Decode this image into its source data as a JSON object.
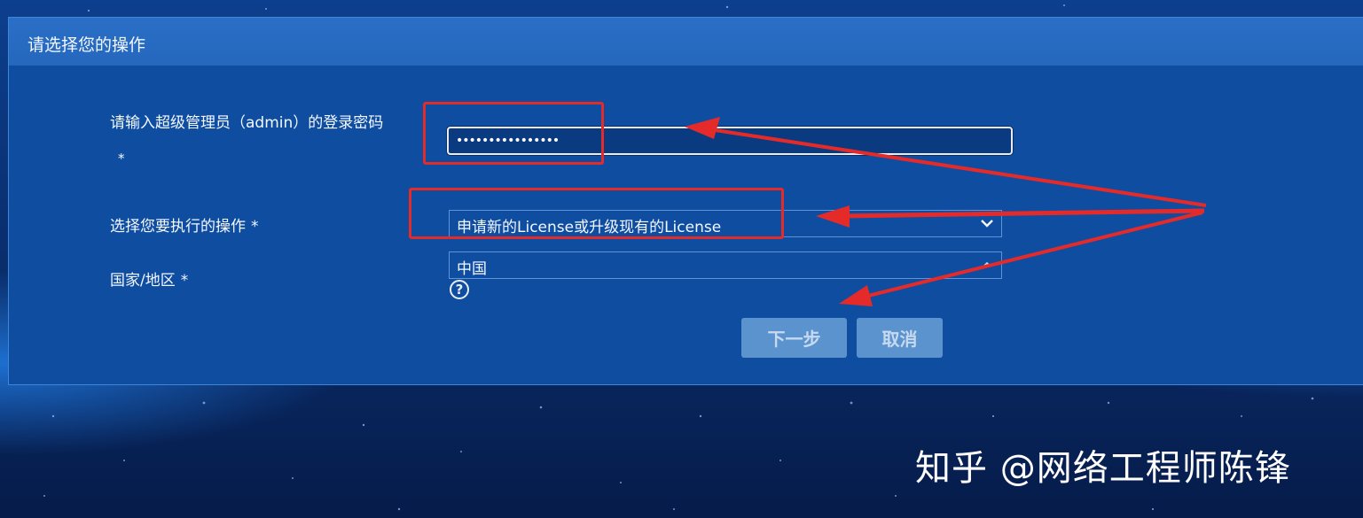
{
  "dialog": {
    "title": "请选择您的操作"
  },
  "form": {
    "password_label": "请输入超级管理员（admin）的登录密码",
    "required_mark": "*",
    "password_value": "••••••••••••••••",
    "operation_label": "选择您要执行的操作",
    "operation_value": "申请新的License或升级现有的License",
    "region_label": "国家/地区",
    "region_value": "中国"
  },
  "buttons": {
    "next": "下一步",
    "cancel": "取消"
  },
  "watermark": {
    "text": "知乎 @网络工程师陈锋"
  },
  "colors": {
    "annotation": "#e52a2a",
    "panel": "#0f4da1",
    "header": "#2a6fc6",
    "button": "#5b93cf"
  },
  "icons": {
    "dropdown": "chevron-down-icon",
    "help": "question-circle-icon"
  }
}
